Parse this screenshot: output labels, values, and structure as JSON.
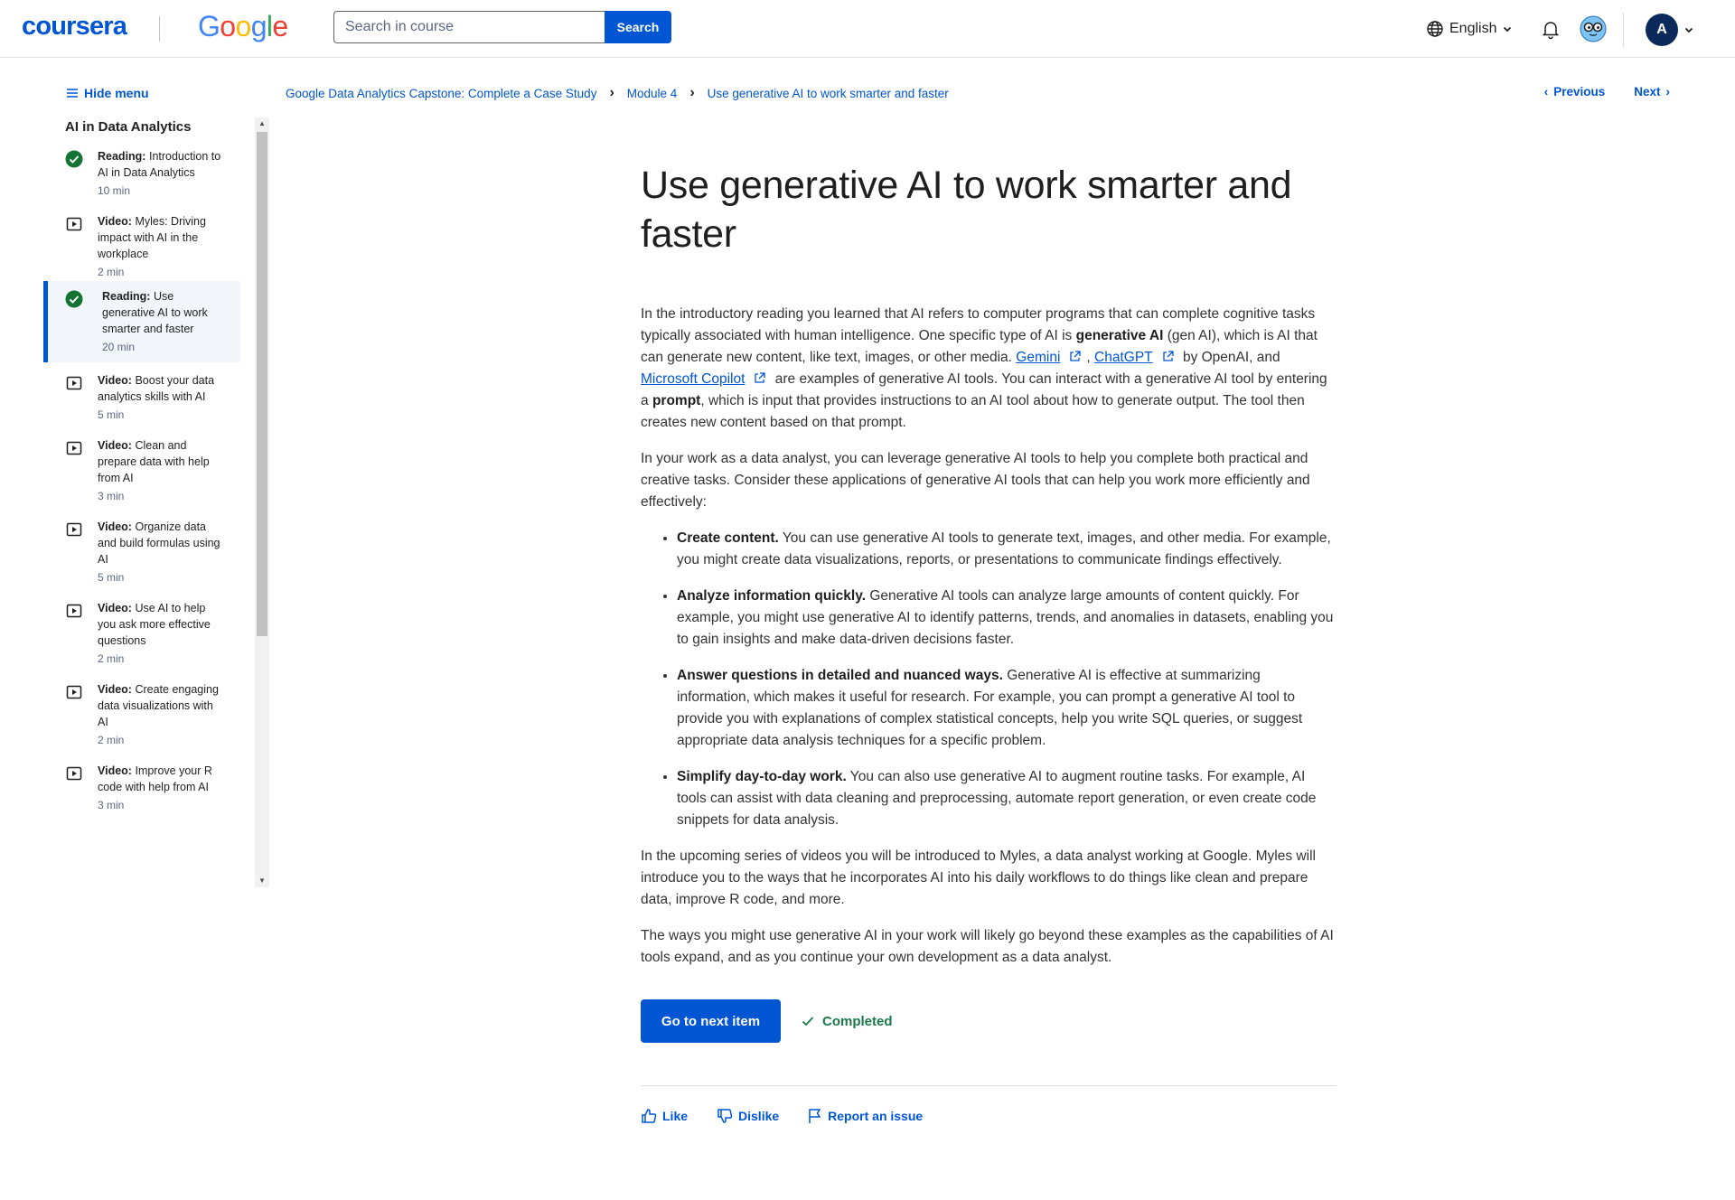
{
  "header": {
    "logo_text": "coursera",
    "partner_logo": [
      "G",
      "o",
      "o",
      "g",
      "l",
      "e"
    ],
    "search_placeholder": "Search in course",
    "search_button": "Search",
    "language": "English",
    "avatar_initial": "A"
  },
  "sidebar": {
    "hide_menu": "Hide menu",
    "module_title": "AI in Data Analytics",
    "items": [
      {
        "type": "Reading:",
        "title": "Introduction to AI in Data Analytics",
        "duration": "10 min",
        "icon": "check-circle-icon",
        "completed": true
      },
      {
        "type": "Video:",
        "title": "Myles: Driving impact with AI in the workplace",
        "duration": "2 min",
        "icon": "play-video-icon",
        "completed": false
      },
      {
        "type": "Reading:",
        "title": "Use generative AI to work smarter and faster",
        "duration": "20 min",
        "icon": "check-circle-icon",
        "completed": true,
        "active": true
      },
      {
        "type": "Video:",
        "title": "Boost your data analytics skills with AI",
        "duration": "5 min",
        "icon": "play-video-icon",
        "completed": false
      },
      {
        "type": "Video:",
        "title": "Clean and prepare data with help from AI",
        "duration": "3 min",
        "icon": "play-video-icon",
        "completed": false
      },
      {
        "type": "Video:",
        "title": "Organize data and build formulas using AI",
        "duration": "5 min",
        "icon": "play-video-icon",
        "completed": false
      },
      {
        "type": "Video:",
        "title": "Use AI to help you ask more effective questions",
        "duration": "2 min",
        "icon": "play-video-icon",
        "completed": false
      },
      {
        "type": "Video:",
        "title": "Create engaging data visualizations with AI",
        "duration": "2 min",
        "icon": "play-video-icon",
        "completed": false
      },
      {
        "type": "Video:",
        "title": "Improve your R code with help from AI",
        "duration": "3 min",
        "icon": "play-video-icon",
        "completed": false
      }
    ]
  },
  "breadcrumb": {
    "course": "Google Data Analytics Capstone: Complete a Case Study",
    "module": "Module 4",
    "current": "Use generative AI to work smarter and faster"
  },
  "nav": {
    "previous": "Previous",
    "next": "Next"
  },
  "article": {
    "title": "Use generative AI to work smarter and faster",
    "p1": {
      "t1": "In the introductory reading you learned that AI refers to computer programs that can complete cognitive tasks typically associated with human intelligence. One specific type of AI is ",
      "b1": "generative AI",
      "t2": " (gen AI), which is AI that can generate new content, like text, images, or other media. ",
      "link1": "Gemini",
      "t3": ", ",
      "link2": "ChatGPT",
      "t4": " by OpenAI, and ",
      "link3": "Microsoft Copilot",
      "t5": " are examples of generative AI tools. You can interact with a generative AI tool by entering a ",
      "b2": "prompt",
      "t6": ", which is input that provides instructions to an AI tool about how to generate output. The tool then creates new content based on that prompt."
    },
    "p2": "In your work as a data analyst, you can leverage generative AI tools to help you complete both practical and creative tasks. Consider these applications of generative AI tools that can help you work more efficiently and effectively:",
    "bullets": [
      {
        "bold": "Create content.",
        "text": " You can use generative AI tools to generate text, images, and other media. For example, you might create data visualizations, reports, or presentations to communicate findings effectively."
      },
      {
        "bold": "Analyze information quickly.",
        "text": " Generative AI tools can analyze large amounts of content quickly. For example, you might use generative AI to identify patterns, trends, and anomalies in datasets, enabling you to gain insights and make data-driven decisions faster."
      },
      {
        "bold": "Answer questions in detailed and nuanced ways.",
        "text": " Generative AI is effective at summarizing information, which makes it useful for research. For example, you can prompt a generative AI tool to provide you with explanations of complex statistical concepts, help you write SQL queries, or suggest appropriate data analysis techniques for a specific problem."
      },
      {
        "bold": "Simplify day-to-day work.",
        "text": " You can also use generative AI to augment routine tasks. For example, AI tools can assist with data cleaning and preprocessing, automate report generation, or even create code snippets for data analysis."
      }
    ],
    "p3": "In the upcoming series of videos you will be introduced to Myles, a data analyst working at Google. Myles will introduce you to the ways that he incorporates AI into his daily workflows to do things like clean and prepare data, improve R code, and more.",
    "p4": "The ways you might use generative AI in your work will likely go beyond these examples as the capabilities of AI tools expand, and as you continue your own development as a data analyst."
  },
  "actions": {
    "next_item": "Go to next item",
    "completed": "Completed"
  },
  "feedback": {
    "like": "Like",
    "dislike": "Dislike",
    "report": "Report an issue"
  },
  "colors": {
    "brand_blue": "#0056d2",
    "completed_green": "#1c7a4a",
    "check_green": "#137333"
  }
}
